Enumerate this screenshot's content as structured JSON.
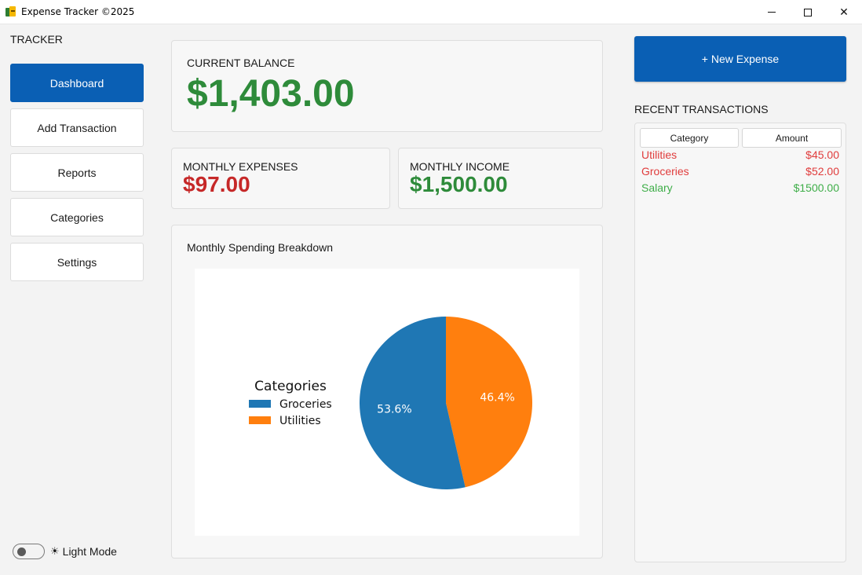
{
  "window": {
    "title": "Expense Tracker ©2025",
    "controls": {
      "minimize_icon": "minimize-icon",
      "maximize_icon": "maximize-icon",
      "close_glyph": "✕"
    }
  },
  "sidebar": {
    "title": "TRACKER",
    "items": [
      {
        "label": "Dashboard",
        "active": true
      },
      {
        "label": "Add Transaction",
        "active": false
      },
      {
        "label": "Reports",
        "active": false
      },
      {
        "label": "Categories",
        "active": false
      },
      {
        "label": "Settings",
        "active": false
      }
    ],
    "theme_toggle": {
      "icon": "☀",
      "label": "Light Mode",
      "on": false
    }
  },
  "balance": {
    "label": "CURRENT BALANCE",
    "amount": "$1,403.00"
  },
  "expenses": {
    "label": "MONTHLY EXPENSES",
    "amount": "$97.00"
  },
  "income": {
    "label": "MONTHLY INCOME",
    "amount": "$1,500.00"
  },
  "chart_panel": {
    "heading": "Monthly Spending Breakdown"
  },
  "chart_data": {
    "type": "pie",
    "legend_title": "Categories",
    "legend_position": "left",
    "slices": [
      {
        "label": "Groceries",
        "value": 53.6,
        "display": "53.6%",
        "color": "#1f77b4"
      },
      {
        "label": "Utilities",
        "value": 46.4,
        "display": "46.4%",
        "color": "#ff7f0e"
      }
    ]
  },
  "actions": {
    "new_expense_label": "+ New Expense"
  },
  "recent": {
    "title": "RECENT TRANSACTIONS",
    "columns": [
      "Category",
      "Amount"
    ],
    "rows": [
      {
        "category": "Utilities",
        "amount": "$45.00",
        "type": "expense"
      },
      {
        "category": "Groceries",
        "amount": "$52.00",
        "type": "expense"
      },
      {
        "category": "Salary",
        "amount": "$1500.00",
        "type": "income"
      }
    ]
  },
  "colors": {
    "accent": "#0a5fb4",
    "positive": "#2e8b3a",
    "negative": "#c62828",
    "tx_expense": "#e03c3c",
    "tx_income": "#3fae49"
  }
}
